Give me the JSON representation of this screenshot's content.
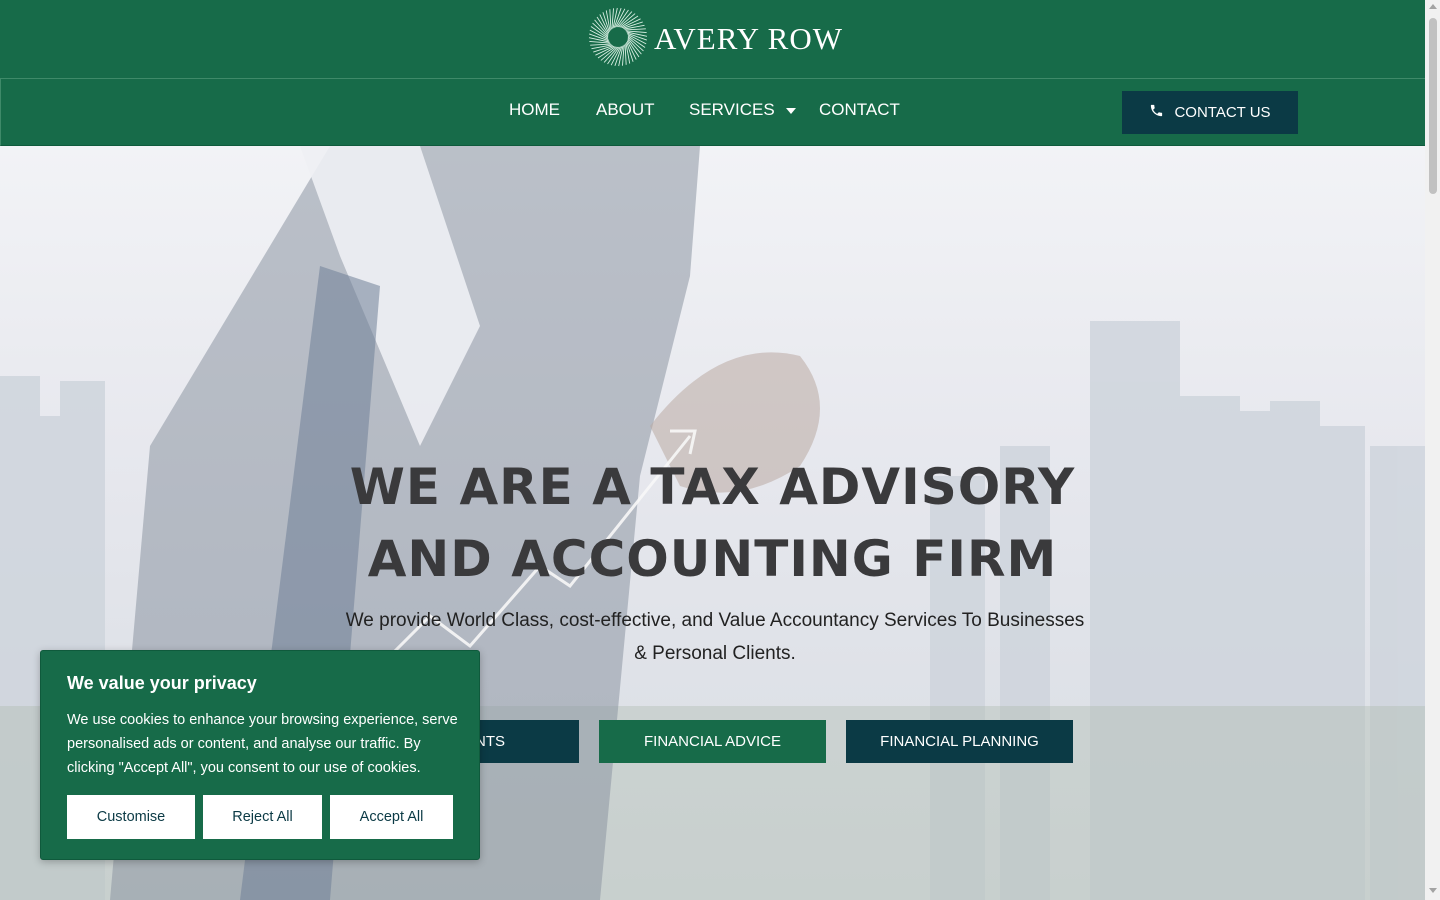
{
  "brand": {
    "name": "AVERY ROW",
    "logo_icon": "radial-circle-logo-icon"
  },
  "nav": {
    "items": [
      {
        "label": "HOME"
      },
      {
        "label": "ABOUT"
      },
      {
        "label": "SERVICES"
      },
      {
        "label": "CONTACT"
      }
    ],
    "services_icon": "caret-down-icon",
    "contact_button": {
      "label": "CONTACT US",
      "icon": "phone-icon"
    }
  },
  "hero": {
    "title_line1": "WE ARE A TAX ADVISORY",
    "title_line2": "AND ACCOUNTING FIRM",
    "subtitle": "We provide World Class, cost-effective, and Value Accountancy Services To Businesses & Personal Clients.",
    "buttons": [
      {
        "label": "NTS"
      },
      {
        "label": "FINANCIAL ADVICE"
      },
      {
        "label": "FINANCIAL PLANNING"
      }
    ]
  },
  "cookie_banner": {
    "title": "We value your privacy",
    "text": "We use cookies to enhance your browsing experience, serve personalised ads or content, and analyse our traffic. By clicking \"Accept All\", you consent to our use of cookies.",
    "buttons": {
      "customise": "Customise",
      "reject": "Reject All",
      "accept": "Accept All"
    }
  },
  "colors": {
    "brand_green": "#176b49",
    "dark_teal": "#0b3a45",
    "heading_gray": "#3a3a3c"
  }
}
